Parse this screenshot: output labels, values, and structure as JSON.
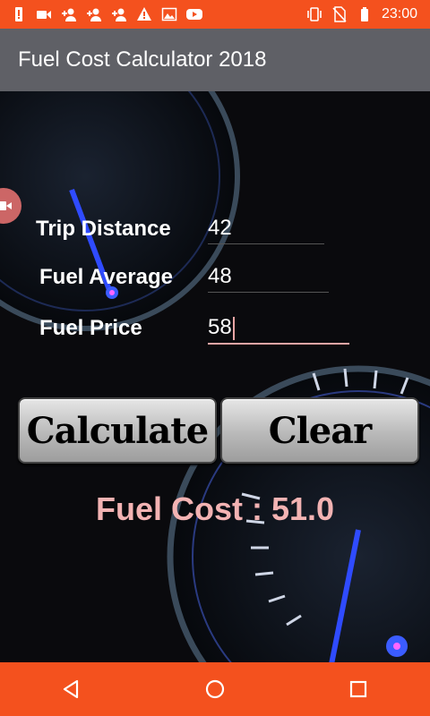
{
  "status_bar": {
    "time": "23:00",
    "icons_left": [
      "alert-icon",
      "video-icon",
      "add-person-icon",
      "add-person-icon",
      "add-person-icon",
      "warning-icon",
      "image-icon",
      "youtube-icon"
    ],
    "icons_right": [
      "vibrate-icon",
      "no-sim-icon",
      "battery-icon"
    ]
  },
  "app_bar": {
    "title": "Fuel Cost Calculator 2018"
  },
  "form": {
    "trip_distance": {
      "label": "Trip Distance",
      "value": "42"
    },
    "fuel_average": {
      "label": "Fuel Average",
      "value": "48"
    },
    "fuel_price": {
      "label": "Fuel Price",
      "value": "58"
    }
  },
  "buttons": {
    "calculate": "Calculate",
    "clear": "Clear"
  },
  "result": {
    "text": "Fuel Cost : 51.0"
  },
  "nav": {
    "back": "back-icon",
    "home": "home-icon",
    "recents": "recents-icon"
  },
  "colors": {
    "accent": "#f4511e",
    "appbar": "#5f6066",
    "result": "#f3b3b3"
  }
}
